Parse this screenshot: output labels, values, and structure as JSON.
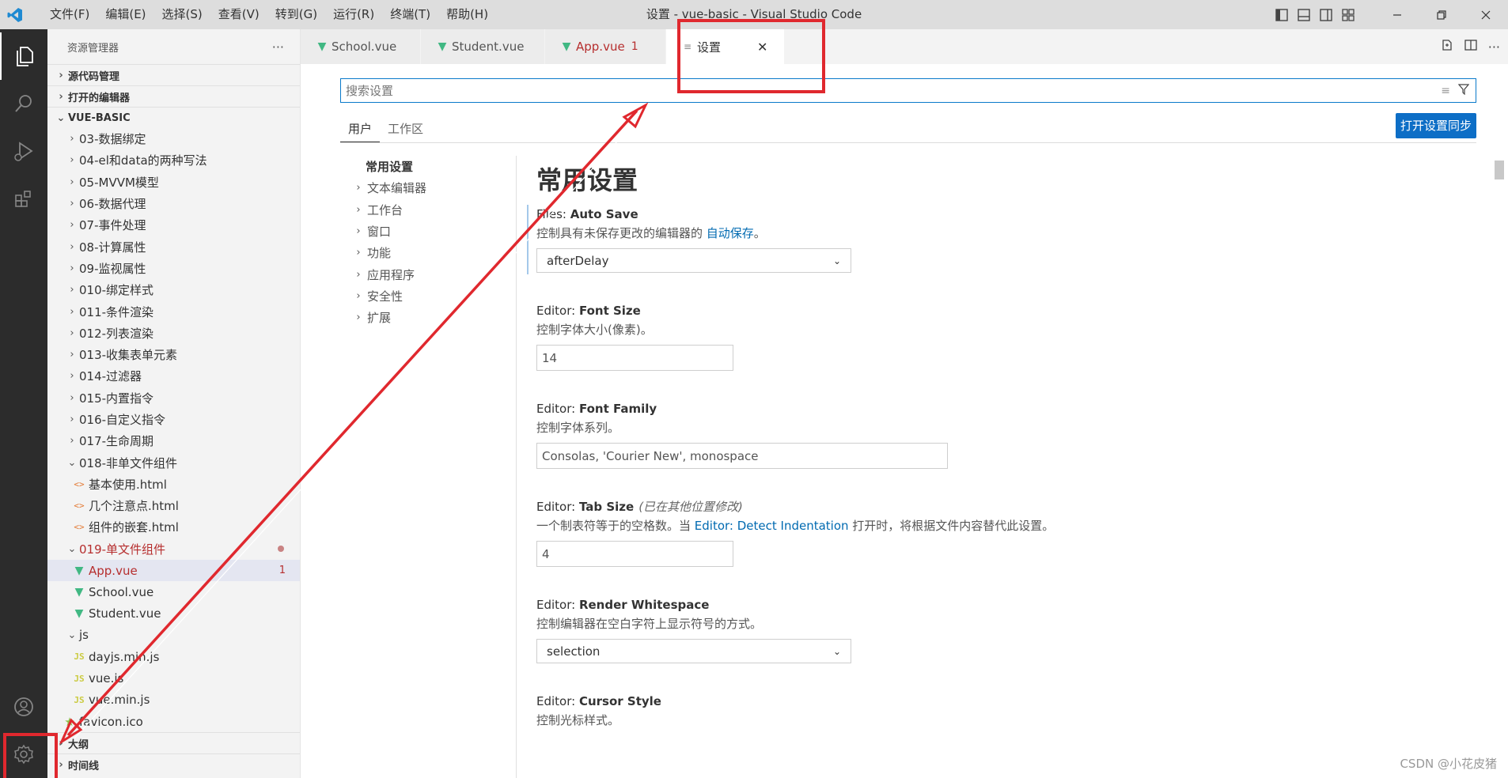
{
  "titlebar": {
    "menus": [
      "文件(F)",
      "编辑(E)",
      "选择(S)",
      "查看(V)",
      "转到(G)",
      "运行(R)",
      "终端(T)",
      "帮助(H)"
    ],
    "title": "设置 - vue-basic - Visual Studio Code"
  },
  "sidebar": {
    "header": "资源管理器",
    "more": "···",
    "section_source": "源代码管理",
    "section_open": "打开的编辑器",
    "section_project": "VUE-BASIC",
    "folders": [
      "03-数据绑定",
      "04-el和data的两种写法",
      "05-MVVM模型",
      "06-数据代理",
      "07-事件处理",
      "08-计算属性",
      "09-监视属性",
      "010-绑定样式",
      "011-条件渲染",
      "012-列表渲染",
      "013-收集表单元素",
      "014-过滤器",
      "015-内置指令",
      "016-自定义指令",
      "017-生命周期"
    ],
    "folder_018": "018-非单文件组件",
    "files_018": [
      "基本使用.html",
      "几个注意点.html",
      "组件的嵌套.html"
    ],
    "folder_019": "019-单文件组件",
    "files_019": [
      {
        "name": "App.vue",
        "badge": "1"
      },
      {
        "name": "School.vue"
      },
      {
        "name": "Student.vue"
      }
    ],
    "folder_js": "js",
    "files_js": [
      "dayjs.min.js",
      "vue.js",
      "vue.min.js"
    ],
    "favicon": "favicon.ico",
    "section_outline": "大纲",
    "section_timeline": "时间线"
  },
  "tabs": [
    {
      "label": "School.vue"
    },
    {
      "label": "Student.vue"
    },
    {
      "label": "App.vue",
      "num": "1"
    },
    {
      "label": "设置"
    }
  ],
  "settings": {
    "search_placeholder": "搜索设置",
    "scope_user": "用户",
    "scope_workspace": "工作区",
    "sync_button": "打开设置同步",
    "toc_root": "常用设置",
    "toc": [
      "文本编辑器",
      "工作台",
      "窗口",
      "功能",
      "应用程序",
      "安全性",
      "扩展"
    ],
    "group_title": "常用设置",
    "items": [
      {
        "category": "Files: ",
        "name": "Auto Save",
        "desc_before": "控制具有未保存更改的编辑器的 ",
        "desc_link": "自动保存",
        "desc_after": "。",
        "value": "afterDelay"
      },
      {
        "category": "Editor: ",
        "name": "Font Size",
        "desc": "控制字体大小(像素)。",
        "value": "14"
      },
      {
        "category": "Editor: ",
        "name": "Font Family",
        "desc": "控制字体系列。",
        "value": "Consolas, 'Courier New', monospace"
      },
      {
        "category": "Editor: ",
        "name": "Tab Size",
        "modified": "(已在其他位置修改)",
        "desc_before": "一个制表符等于的空格数。当 ",
        "desc_link": "Editor: Detect Indentation",
        "desc_after": " 打开时，将根据文件内容替代此设置。",
        "value": "4"
      },
      {
        "category": "Editor: ",
        "name": "Render Whitespace",
        "desc": "控制编辑器在空白字符上显示符号的方式。",
        "value": "selection"
      },
      {
        "category": "Editor: ",
        "name": "Cursor Style",
        "desc": "控制光标样式。"
      }
    ]
  },
  "watermark": "CSDN @小花皮猪",
  "colors": {
    "annotation": "#e0282e",
    "vue_green": "#41b883",
    "accent_blue": "#0d6ec6",
    "error_red": "#b62e2e"
  }
}
